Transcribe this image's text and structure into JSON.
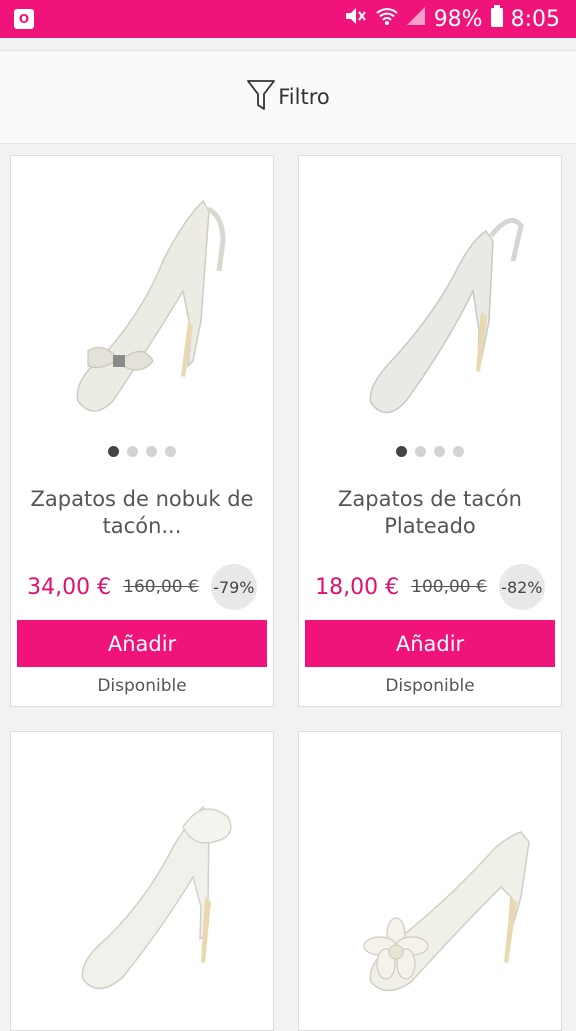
{
  "status_bar": {
    "app_icon": "outlook-icon",
    "icons": [
      "mute-icon",
      "wifi-icon",
      "signal-icon"
    ],
    "battery": "98%",
    "time": "8:05"
  },
  "filter": {
    "label": "Filtro",
    "icon": "funnel-icon"
  },
  "colors": {
    "accent": "#f0137a",
    "price": "#e0106e"
  },
  "products": [
    {
      "image_icon": "slingback-bow-shoe-icon",
      "dots": 4,
      "active_dot": 0,
      "title": "Zapatos de nobuk de tacón...",
      "price": "34,00 €",
      "old_price": "160,00 €",
      "discount": "-79%",
      "button": "Añadir",
      "availability": "Disponible"
    },
    {
      "image_icon": "slingback-silver-shoe-icon",
      "dots": 4,
      "active_dot": 0,
      "title": "Zapatos de tacón Plateado",
      "price": "18,00 €",
      "old_price": "100,00 €",
      "discount": "-82%",
      "button": "Añadir",
      "availability": "Disponible"
    },
    {
      "image_icon": "satin-bow-pump-icon"
    },
    {
      "image_icon": "satin-flower-pump-icon"
    }
  ]
}
